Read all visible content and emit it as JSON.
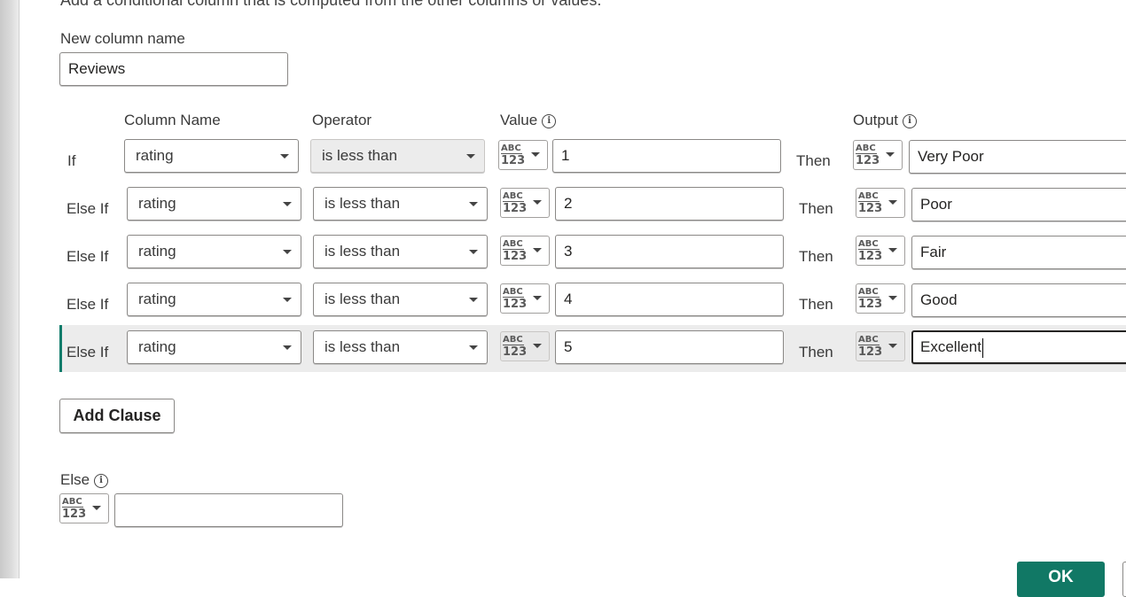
{
  "dialog": {
    "description": "Add a conditional column that is computed from the other columns or values."
  },
  "new_column": {
    "label": "New column name",
    "value": "Reviews"
  },
  "headers": {
    "column_name": "Column Name",
    "operator": "Operator",
    "value": "Value",
    "output": "Output"
  },
  "type_icon": {
    "top": "ABC",
    "bottom": "123"
  },
  "clauses": [
    {
      "prefix": "If",
      "column": "rating",
      "operator": "is less than",
      "value": "1",
      "then": "Then",
      "output": "Very Poor"
    },
    {
      "prefix": "Else If",
      "column": "rating",
      "operator": "is less than",
      "value": "2",
      "then": "Then",
      "output": "Poor"
    },
    {
      "prefix": "Else If",
      "column": "rating",
      "operator": "is less than",
      "value": "3",
      "then": "Then",
      "output": "Fair"
    },
    {
      "prefix": "Else If",
      "column": "rating",
      "operator": "is less than",
      "value": "4",
      "then": "Then",
      "output": "Good"
    },
    {
      "prefix": "Else If",
      "column": "rating",
      "operator": "is less than",
      "value": "5",
      "then": "Then",
      "output": "Excellent"
    }
  ],
  "add_clause_label": "Add Clause",
  "else": {
    "label": "Else",
    "value": ""
  },
  "footer": {
    "ok_label": "OK"
  },
  "colors": {
    "accent": "#117865",
    "selected_row": "#ececec"
  }
}
